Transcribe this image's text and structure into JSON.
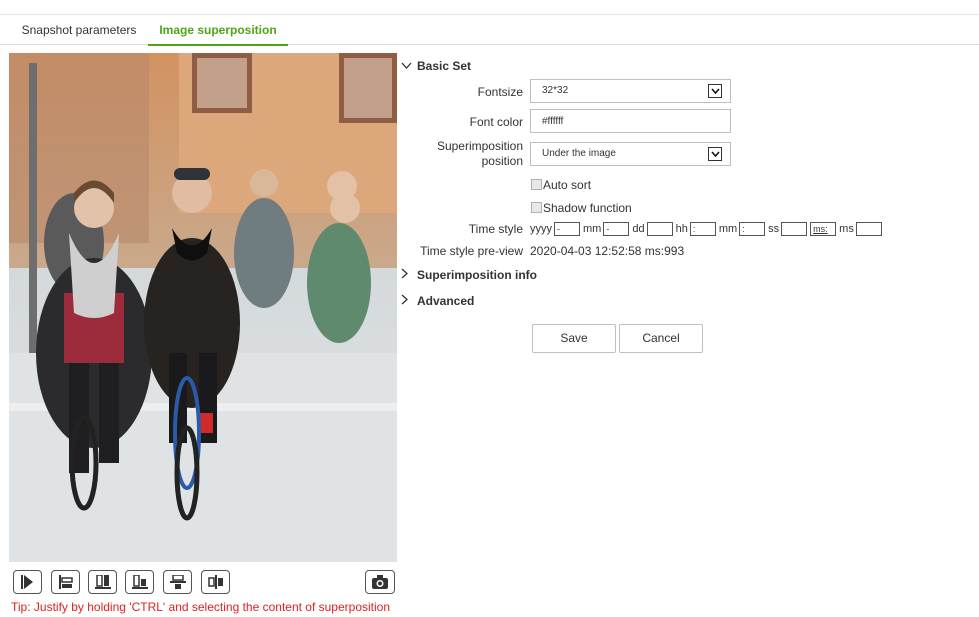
{
  "tabs": [
    {
      "label": "Snapshot parameters"
    },
    {
      "label": "Image superposition"
    }
  ],
  "accent_color": "#4fa319",
  "toolbar": {
    "icons": [
      "play-icon",
      "align-bottom-icon",
      "align-left-icon",
      "align-right-icon",
      "align-center-horizontal-icon",
      "align-center-vertical-icon"
    ],
    "snapshot_icon": "camera-icon"
  },
  "tip": "Tip: Justify by holding 'CTRL' and selecting the content of superposition",
  "basic_set": {
    "title": "Basic Set",
    "fontsize_label": "Fontsize",
    "fontsize_value": "32*32",
    "font_color_label": "Font color",
    "font_color_value": "#ffffff",
    "position_label_1": "Superimposition",
    "position_label_2": "position",
    "position_value": "Under the image",
    "auto_sort_label": "Auto sort",
    "shadow_label": "Shadow function",
    "time_style_label": "Time style",
    "time_style": {
      "yyyy": "yyyy",
      "sep1": "-",
      "mm1": "mm",
      "sep2": "-",
      "dd": "dd",
      "sep3": "",
      "hh": "hh",
      "sep4": ":",
      "mm2": "mm",
      "sep5": ":",
      "ss": "ss",
      "sep6": "",
      "ms_box": "ms:",
      "ms": "ms",
      "sep7": ""
    },
    "time_preview_label": "Time style pre-view",
    "time_preview_value": "2020-04-03 12:52:58 ms:993"
  },
  "superimposition_info": {
    "title": "Superimposition info"
  },
  "advanced": {
    "title": "Advanced"
  },
  "buttons": {
    "save": "Save",
    "cancel": "Cancel"
  }
}
